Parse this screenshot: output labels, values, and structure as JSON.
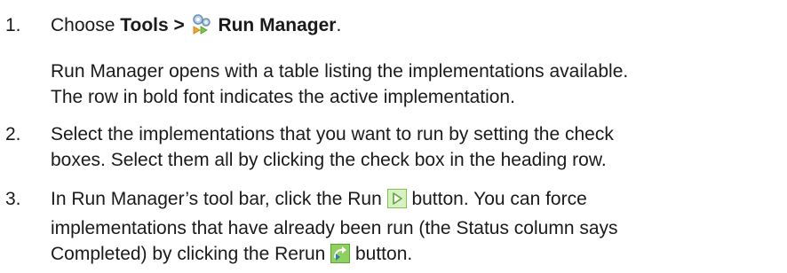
{
  "steps": [
    {
      "number": "1.",
      "prefix": "Choose ",
      "menu_path": "Tools > ",
      "menu_icon": "run-manager-icon",
      "menu_item": "Run Manager",
      "suffix": ".",
      "note_line1": "Run Manager opens with a table listing the implementations available.",
      "note_line2": "The row in bold font indicates the active implementation."
    },
    {
      "number": "2.",
      "line1": "Select the implementations that you want to run by setting the check",
      "line2": "boxes. Select them all by clicking the check box in the heading row."
    },
    {
      "number": "3.",
      "line1_pre": "In Run Manager’s tool bar, click the Run ",
      "run_icon": "run-icon",
      "line1_post": " button. You can force",
      "line2": "implementations that have already been run (the Status column says",
      "line3_pre": "Completed) by clicking the Rerun ",
      "rerun_icon": "rerun-icon",
      "line3_post": " button."
    }
  ],
  "colors": {
    "text": "#1a1a1a",
    "run_icon_green": "#7ac943",
    "rerun_icon_green": "#5aa832"
  }
}
